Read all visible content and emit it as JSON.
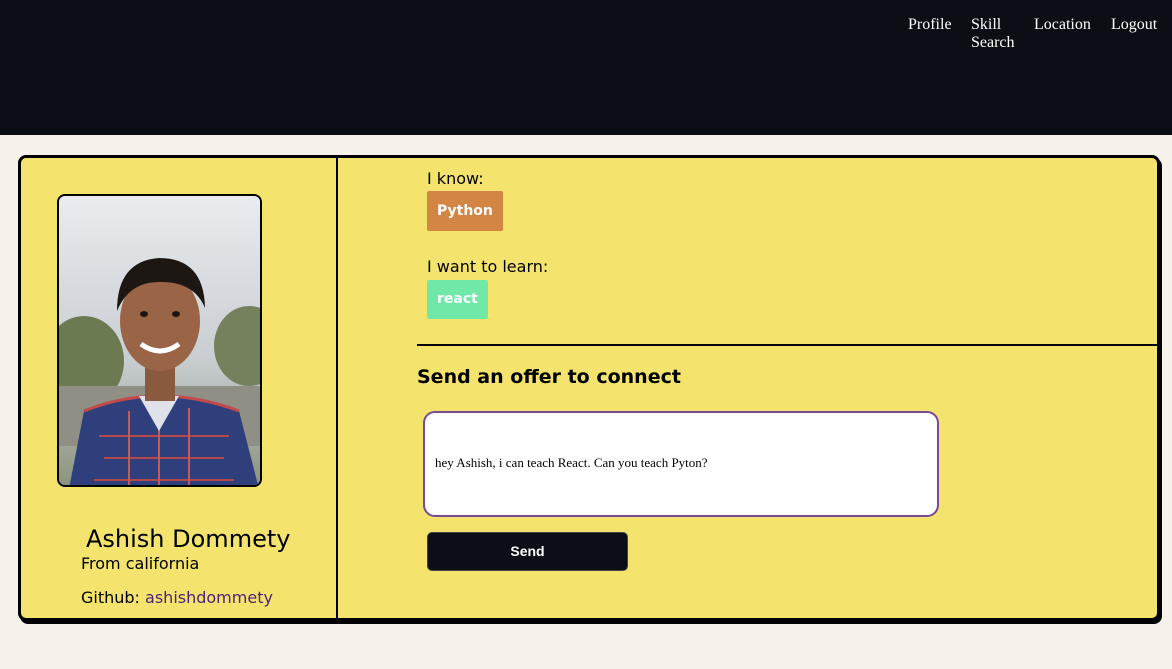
{
  "nav": {
    "profile": "Profile",
    "skill_search": "Skill Search",
    "location": "Location",
    "logout": "Logout"
  },
  "profile": {
    "name": "Ashish Dommety",
    "from": "From california",
    "github_label": "Github: ",
    "github_user": "ashishdommety"
  },
  "skills": {
    "know_label": "I know:",
    "know": [
      "Python"
    ],
    "learn_label": "I want to learn:",
    "learn": [
      "react"
    ]
  },
  "offer": {
    "title": "Send an offer to connect",
    "message": "hey Ashish, i can teach React. Can you teach Pyton?",
    "send_label": "Send"
  },
  "colors": {
    "navbar": "#0b0e15",
    "card": "#f4e46d",
    "page_bg": "#f6f1eb",
    "know_tag": "#d38644",
    "learn_tag": "#6fe8a8",
    "link": "#4a1f7a"
  }
}
